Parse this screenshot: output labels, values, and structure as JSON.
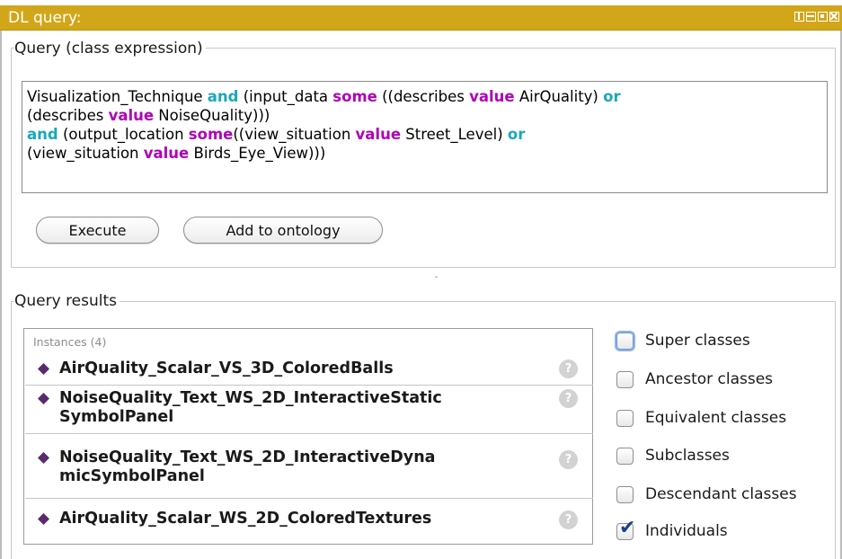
{
  "window": {
    "title": "DL query:",
    "accent_color": "#d2a619"
  },
  "query": {
    "group_label": "Query (class expression)",
    "line1_a": "Visualization_Technique ",
    "line1_and": "and",
    "line1_b": " (input_data ",
    "line1_some": "some",
    "line1_c": " ((describes ",
    "line1_value": "value",
    "line1_d": " AirQuality) ",
    "line1_or": "or",
    "line2_a": "(describes ",
    "line2_value": "value",
    "line2_b": " NoiseQuality)))",
    "line3_and": "and",
    "line3_a": " (output_location ",
    "line3_some": "some",
    "line3_b": "((view_situation ",
    "line3_value": "value",
    "line3_c": " Street_Level) ",
    "line3_or": "or",
    "line4_a": "(view_situation ",
    "line4_value": "value",
    "line4_b": " Birds_Eye_View)))",
    "execute_label": "Execute",
    "add_label": "Add to ontology"
  },
  "results": {
    "group_label": "Query results",
    "header": "Instances (4)",
    "items": [
      {
        "name": "AirQuality_Scalar_VS_3D_ColoredBalls"
      },
      {
        "name": "NoiseQuality_Text_WS_2D_InteractiveStatic SymbolPanel"
      },
      {
        "name": "NoiseQuality_Text_WS_2D_InteractiveDyna micSymbolPanel"
      },
      {
        "name": "AirQuality_Scalar_WS_2D_ColoredTextures"
      }
    ],
    "help_glyph": "?"
  },
  "options": [
    {
      "label": "Super classes",
      "checked": false
    },
    {
      "label": "Ancestor classes",
      "checked": false
    },
    {
      "label": "Equivalent classes",
      "checked": false
    },
    {
      "label": "Subclasses",
      "checked": false
    },
    {
      "label": "Descendant classes",
      "checked": false
    },
    {
      "label": "Individuals",
      "checked": true
    }
  ],
  "icons": {
    "instance": "purple-diamond-icon",
    "help": "question-mark-icon",
    "check": "checkmark-icon"
  }
}
